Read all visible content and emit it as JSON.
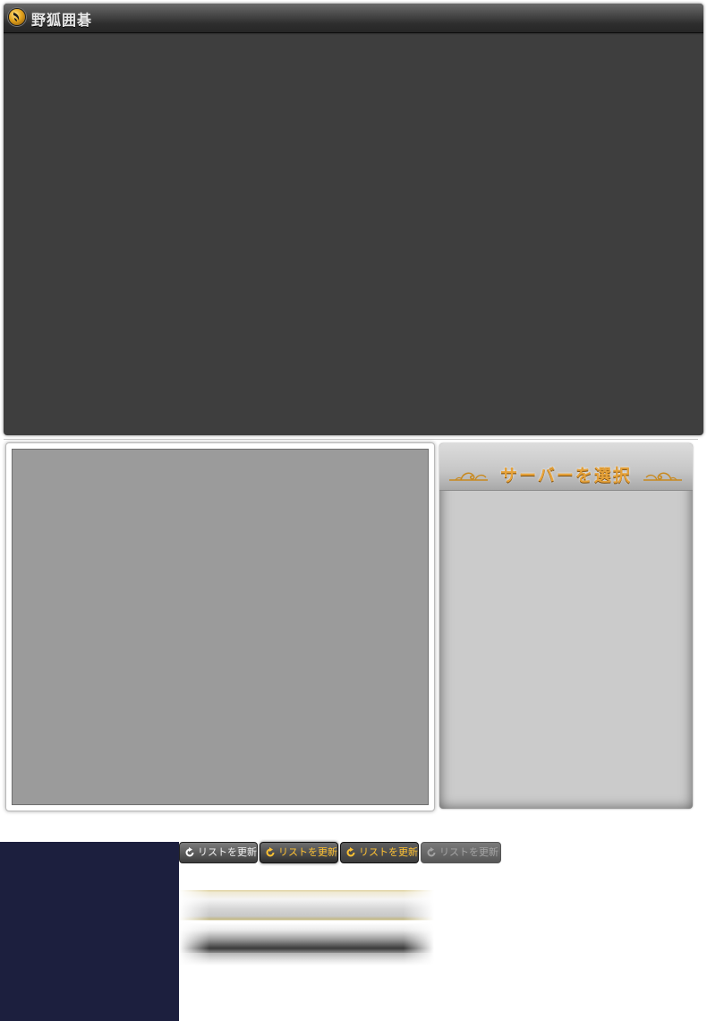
{
  "window": {
    "title": "野狐囲碁"
  },
  "server_panel": {
    "title": "サーバーを選択"
  },
  "refresh_buttons": [
    {
      "label": "リストを更新",
      "state": "normal"
    },
    {
      "label": "リストを更新",
      "state": "hover"
    },
    {
      "label": "リストを更新",
      "state": "pressed"
    },
    {
      "label": "リストを更新",
      "state": "disabled"
    }
  ],
  "icons": {
    "app_logo": "foxwq-logo-icon",
    "refresh": "refresh-icon",
    "ornament": "gold-flourish-icon"
  },
  "colors": {
    "window_bg": "#3e3e3e",
    "board_bg": "#9b9b9b",
    "server_panel_bg": "#cbcbcb",
    "server_title": "#e6a23a",
    "accent_gold": "#ffc233",
    "navy": "#1c1f3e"
  }
}
